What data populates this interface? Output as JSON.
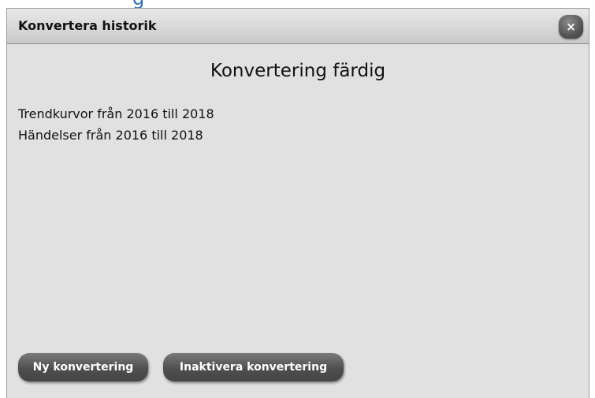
{
  "dialog": {
    "title": "Konvertera historik",
    "close_label": "×",
    "heading": "Konvertering färdig",
    "lines": [
      "Trendkurvor från 2016 till 2018",
      "Händelser från 2016 till 2018"
    ],
    "buttons": {
      "new_conversion": "Ny konvertering",
      "disable_conversion": "Inaktivera konvertering"
    }
  },
  "colors": {
    "dialog_background": "#e1e1e1",
    "button_background": "#4f4f4f",
    "button_text": "#ffffff",
    "background_link_text": "#2f6fb8"
  }
}
